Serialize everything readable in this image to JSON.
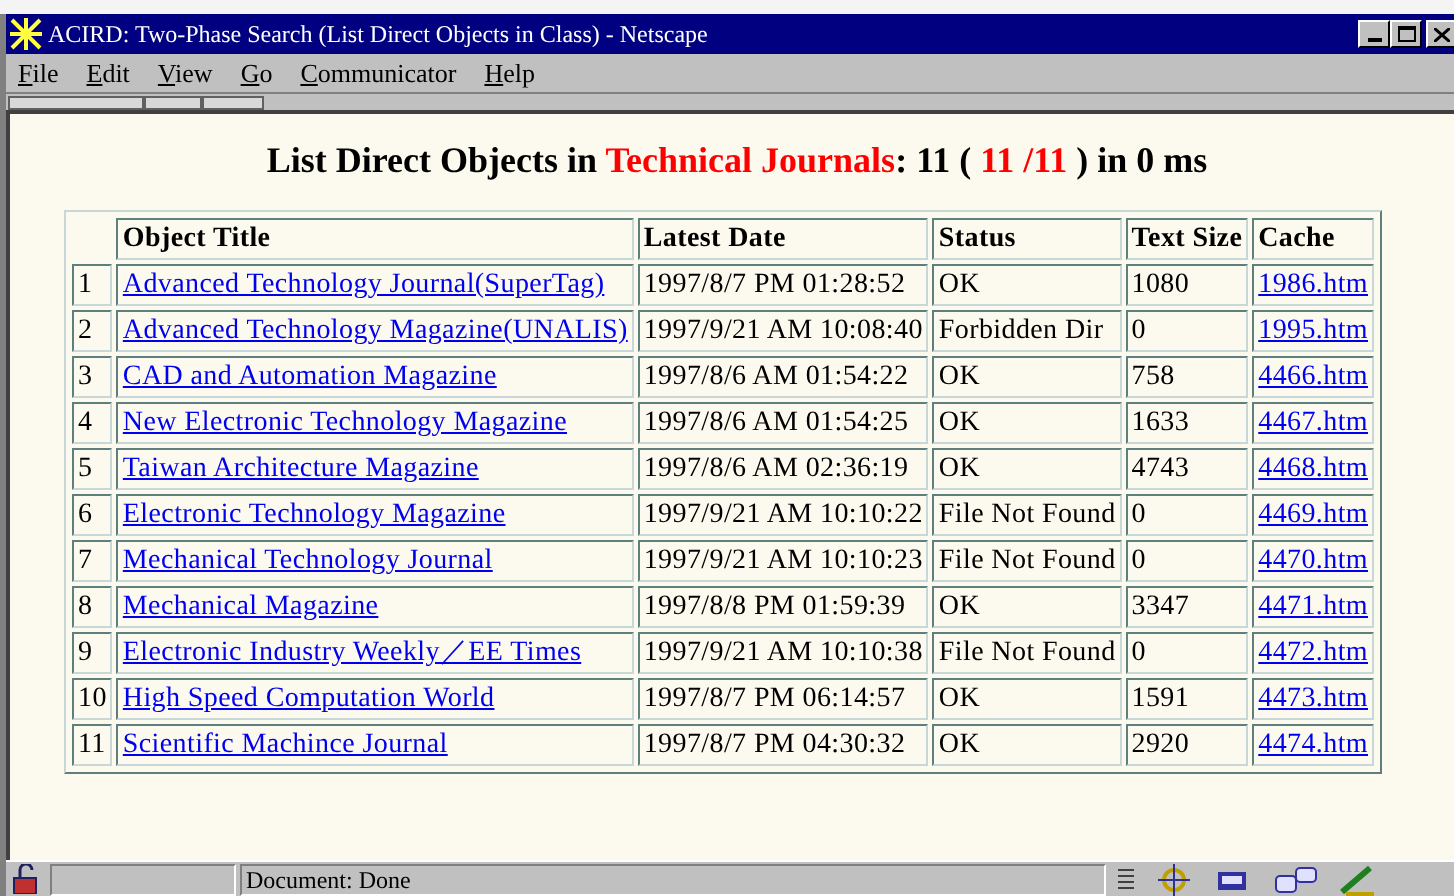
{
  "window": {
    "title": "ACIRD: Two-Phase Search (List Direct Objects in Class) - Netscape"
  },
  "menu": [
    "File",
    "Edit",
    "View",
    "Go",
    "Communicator",
    "Help"
  ],
  "heading": [
    {
      "text": "List Direct Objects in ",
      "highlight": false
    },
    {
      "text": "Technical Journals",
      "highlight": true
    },
    {
      "text": ": 11 ( ",
      "highlight": false
    },
    {
      "text": "11 /11",
      "highlight": true
    },
    {
      "text": " ) in 0 ms",
      "highlight": false
    }
  ],
  "table": {
    "columns": [
      "Object Title",
      "Latest Date",
      "Status",
      "Text Size",
      "Cache"
    ],
    "rows": [
      {
        "number": "1",
        "title": "Advanced Technology Journal(SuperTag)",
        "date": "1997/8/7 PM 01:28:52",
        "status": "OK",
        "size": "1080",
        "cache": "1986.htm"
      },
      {
        "number": "2",
        "title": "Advanced Technology Magazine(UNALIS)",
        "date": "1997/9/21 AM 10:08:40",
        "status": "Forbidden Dir",
        "size": "0",
        "cache": "1995.htm"
      },
      {
        "number": "3",
        "title": "CAD and Automation Magazine",
        "date": "1997/8/6 AM 01:54:22",
        "status": "OK",
        "size": "758",
        "cache": "4466.htm"
      },
      {
        "number": "4",
        "title": "New Electronic Technology Magazine",
        "date": "1997/8/6 AM 01:54:25",
        "status": "OK",
        "size": "1633",
        "cache": "4467.htm"
      },
      {
        "number": "5",
        "title": "Taiwan Architecture Magazine",
        "date": "1997/8/6 AM 02:36:19",
        "status": "OK",
        "size": "4743",
        "cache": "4468.htm"
      },
      {
        "number": "6",
        "title": "Electronic Technology Magazine",
        "date": "1997/9/21 AM 10:10:22",
        "status": "File Not Found",
        "size": "0",
        "cache": "4469.htm"
      },
      {
        "number": "7",
        "title": "Mechanical Technology Journal",
        "date": "1997/9/21 AM 10:10:23",
        "status": "File Not Found",
        "size": "0",
        "cache": "4470.htm"
      },
      {
        "number": "8",
        "title": "Mechanical Magazine",
        "date": "1997/8/8 PM 01:59:39",
        "status": "OK",
        "size": "3347",
        "cache": "4471.htm"
      },
      {
        "number": "9",
        "title": "Electronic Industry Weekly／EE Times",
        "date": "1997/9/21 AM 10:10:38",
        "status": "File Not Found",
        "size": "0",
        "cache": "4472.htm"
      },
      {
        "number": "10",
        "title": "High Speed Computation World",
        "date": "1997/8/7 PM 06:14:57",
        "status": "OK",
        "size": "1591",
        "cache": "4473.htm"
      },
      {
        "number": "11",
        "title": "Scientific Machince Journal",
        "date": "1997/8/7 PM 04:30:32",
        "status": "OK",
        "size": "2920",
        "cache": "4474.htm"
      }
    ]
  },
  "status_bar": {
    "text": "Document: Done"
  }
}
